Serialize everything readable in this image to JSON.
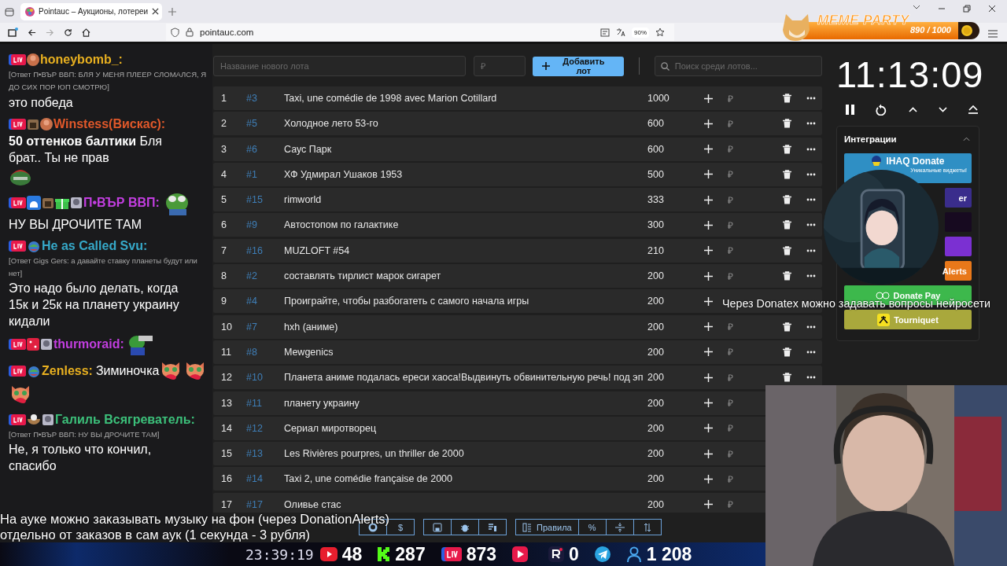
{
  "browser": {
    "tab_title": "Pointauc – Аукционы, лотереи",
    "url": "pointauc.com",
    "zoom": "90%"
  },
  "meme_party": {
    "title": "MEME PARTY",
    "reading": "890 / 1000",
    "level": 0.89
  },
  "chat": [
    {
      "user": "honeybomb_:",
      "color": "#e8b020",
      "reply": "[Ответ П•ВЪР ВВП: БЛЯ У МЕНЯ ПЛЕЕР СЛОМАЛСЯ, Я ДО СИХ ПОР ЮП СМОТРЮ]",
      "text": "это победа"
    },
    {
      "user": "Winstess(Вискас):",
      "color": "#e0582a",
      "text": "**50 оттенков балтики** Бля брат.. Ты не прав"
    },
    {
      "user": "П•ВЪР ВВП:",
      "color": "#c23ee0",
      "text": "НУ ВЫ ДРОЧИТЕ ТАМ"
    },
    {
      "user": "He as Called Svu:",
      "color": "#36a9c9",
      "reply": "[Ответ Gigs Gers: а давайте  ставку планеты будут или нет]",
      "text": "Это надо было делать, когда 15к и 25к на планету украину кидали"
    },
    {
      "user": "thurmoraid:",
      "color": "#c23ee0"
    },
    {
      "user": "Zenless:",
      "color": "#e8b020",
      "text": "Зиминочка"
    },
    {
      "user": "Галиль Всягреватель:",
      "color": "#3cc07a",
      "reply": "[Ответ П•ВЪР ВВП: НУ ВЫ ДРОЧИТЕ ТАМ]",
      "text": "Не, я только что кончил, спасибо"
    }
  ],
  "lot_form": {
    "name_placeholder": "Название нового лота",
    "price_placeholder": "₽",
    "add_button": "Добавить лот",
    "search_placeholder": "Поиск среди лотов..."
  },
  "lots": [
    {
      "number": "1",
      "id": "#3",
      "name": "Taxi, une comédie de 1998 avec Marion Cotillard",
      "amount": "1000",
      "currency": "₽"
    },
    {
      "number": "2",
      "id": "#5",
      "name": "Холодное лето 53-го",
      "amount": "600",
      "currency": "₽"
    },
    {
      "number": "3",
      "id": "#6",
      "name": "Саус Парк",
      "amount": "600",
      "currency": "₽"
    },
    {
      "number": "4",
      "id": "#1",
      "name": "ХФ Удмирал Ушаков 1953",
      "amount": "500",
      "currency": "₽"
    },
    {
      "number": "5",
      "id": "#15",
      "name": "rimworld",
      "amount": "333",
      "currency": "₽"
    },
    {
      "number": "6",
      "id": "#9",
      "name": "Автостопом по галактике",
      "amount": "300",
      "currency": "₽"
    },
    {
      "number": "7",
      "id": "#16",
      "name": "MUZLOFT #54",
      "amount": "210",
      "currency": "₽"
    },
    {
      "number": "8",
      "id": "#2",
      "name": "составлять тирлист марок сигарет",
      "amount": "200",
      "currency": "₽"
    },
    {
      "number": "9",
      "id": "#4",
      "name": "Проиграйте, чтобы разбогатеть с самого начала игры",
      "amount": "200"
    },
    {
      "number": "10",
      "id": "#7",
      "name": "hxh (аниме)",
      "amount": "200",
      "currency": "₽"
    },
    {
      "number": "11",
      "id": "#8",
      "name": "Mewgenics",
      "amount": "200",
      "currency": "₽"
    },
    {
      "number": "12",
      "id": "#10",
      "name": "Планета аниме подалась ереси хаоса!Выдвинуть обвинительную речь! под эп",
      "amount": "200",
      "currency": "₽"
    },
    {
      "number": "13",
      "id": "#11",
      "name": "планету украину",
      "amount": "200",
      "currency": "₽"
    },
    {
      "number": "14",
      "id": "#12",
      "name": "Сериал миротворец",
      "amount": "200",
      "currency": "₽"
    },
    {
      "number": "15",
      "id": "#13",
      "name": "Les Rivières pourpres, un thriller de 2000",
      "amount": "200",
      "currency": "₽"
    },
    {
      "number": "16",
      "id": "#14",
      "name": "Taxi 2, une comédie française de 2000",
      "amount": "200",
      "currency": "₽"
    },
    {
      "number": "17",
      "id": "#17",
      "name": "Оливье стас",
      "amount": "200",
      "currency": "₽"
    }
  ],
  "toolbar": {
    "dollar": "$",
    "rules": "Правила",
    "percent": "%"
  },
  "timer": {
    "time": "11:13:09"
  },
  "integrations": {
    "title": "Интеграции",
    "expanded": true,
    "items": [
      {
        "label": "IHAQ Donate",
        "subtitle": "Уникальные виджеты!",
        "color": "#2f8fc4"
      },
      {
        "label": "er",
        "color": "#3a2d8c"
      },
      {
        "color": "#170a20"
      },
      {
        "color": "#7b30d2"
      },
      {
        "label": "Alerts",
        "color": "#e8781a"
      },
      {
        "label": "Donate Pay",
        "color": "#3db84c"
      },
      {
        "label": "Tourniquet",
        "color": "#a9a83c"
      }
    ]
  },
  "captions": [
    "На ауке можно заказывать музыку на фон (через DonationAlerts)",
    "отдельно от заказов в сам аук (1 секунда - 3 рубля)"
  ],
  "side_caption": "Через Donatex можно задавать вопросы нейросети",
  "stream_bar": {
    "clock": "23:39:19",
    "stats": [
      {
        "kind": "youtube",
        "value": "48"
      },
      {
        "kind": "kick",
        "value": "287"
      },
      {
        "kind": "live",
        "value": "873"
      },
      {
        "kind": "play"
      },
      {
        "kind": "rutube",
        "value": "0"
      },
      {
        "kind": "telegram"
      },
      {
        "kind": "viewers",
        "value": "1 208"
      }
    ]
  }
}
